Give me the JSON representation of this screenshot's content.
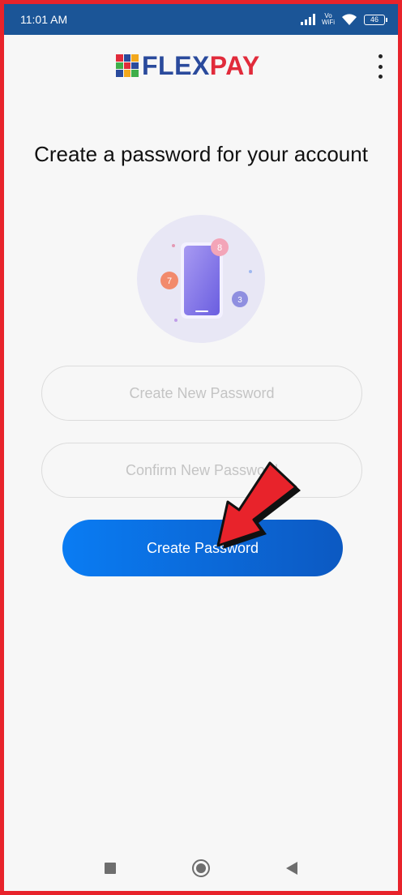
{
  "status_bar": {
    "time": "11:01 AM",
    "vowifi_line1": "Vo",
    "vowifi_line2": "WiFi",
    "battery": "46"
  },
  "header": {
    "logo_flex": "FLEX",
    "logo_pay": "PAY",
    "menu_icon": "more-vert-icon"
  },
  "main": {
    "title": "Create a password for your account",
    "illustration_badges": [
      "8",
      "7",
      "3"
    ],
    "new_password_placeholder": "Create New Password",
    "confirm_password_placeholder": "Confirm New Password",
    "submit_label": "Create Password"
  },
  "nav": {
    "recents_icon": "square-icon",
    "home_icon": "circle-icon",
    "back_icon": "triangle-back-icon"
  },
  "colors": {
    "status_bar": "#1b5597",
    "brand_blue": "#2a4a9c",
    "brand_red": "#e12b3b",
    "button_start": "#0a7cf3",
    "button_end": "#0c59c2",
    "annotation_arrow": "#e8232b"
  }
}
